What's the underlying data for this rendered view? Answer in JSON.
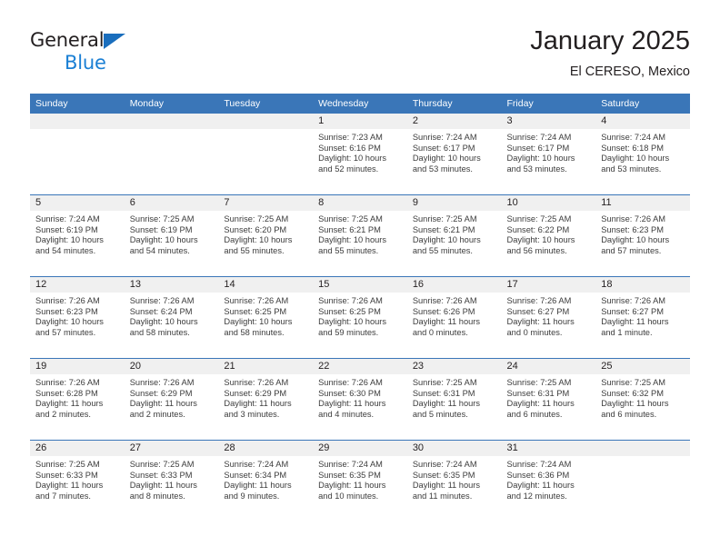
{
  "brand": {
    "line1": "General",
    "line2": "Blue",
    "flag_color": "#1a6ebd",
    "line2_color": "#1a7fd4"
  },
  "header": {
    "month_title": "January 2025",
    "location": "El CERESO, Mexico"
  },
  "theme": {
    "header_blue": "#3a76b8",
    "daynum_bg": "#f0f0f0",
    "text": "#231f20"
  },
  "calendar": {
    "weekday_headers": [
      "Sunday",
      "Monday",
      "Tuesday",
      "Wednesday",
      "Thursday",
      "Friday",
      "Saturday"
    ],
    "weeks": [
      [
        {
          "day": "",
          "sunrise": "",
          "sunset": "",
          "daylight1": "",
          "daylight2": ""
        },
        {
          "day": "",
          "sunrise": "",
          "sunset": "",
          "daylight1": "",
          "daylight2": ""
        },
        {
          "day": "",
          "sunrise": "",
          "sunset": "",
          "daylight1": "",
          "daylight2": ""
        },
        {
          "day": "1",
          "sunrise": "Sunrise: 7:23 AM",
          "sunset": "Sunset: 6:16 PM",
          "daylight1": "Daylight: 10 hours",
          "daylight2": "and 52 minutes."
        },
        {
          "day": "2",
          "sunrise": "Sunrise: 7:24 AM",
          "sunset": "Sunset: 6:17 PM",
          "daylight1": "Daylight: 10 hours",
          "daylight2": "and 53 minutes."
        },
        {
          "day": "3",
          "sunrise": "Sunrise: 7:24 AM",
          "sunset": "Sunset: 6:17 PM",
          "daylight1": "Daylight: 10 hours",
          "daylight2": "and 53 minutes."
        },
        {
          "day": "4",
          "sunrise": "Sunrise: 7:24 AM",
          "sunset": "Sunset: 6:18 PM",
          "daylight1": "Daylight: 10 hours",
          "daylight2": "and 53 minutes."
        }
      ],
      [
        {
          "day": "5",
          "sunrise": "Sunrise: 7:24 AM",
          "sunset": "Sunset: 6:19 PM",
          "daylight1": "Daylight: 10 hours",
          "daylight2": "and 54 minutes."
        },
        {
          "day": "6",
          "sunrise": "Sunrise: 7:25 AM",
          "sunset": "Sunset: 6:19 PM",
          "daylight1": "Daylight: 10 hours",
          "daylight2": "and 54 minutes."
        },
        {
          "day": "7",
          "sunrise": "Sunrise: 7:25 AM",
          "sunset": "Sunset: 6:20 PM",
          "daylight1": "Daylight: 10 hours",
          "daylight2": "and 55 minutes."
        },
        {
          "day": "8",
          "sunrise": "Sunrise: 7:25 AM",
          "sunset": "Sunset: 6:21 PM",
          "daylight1": "Daylight: 10 hours",
          "daylight2": "and 55 minutes."
        },
        {
          "day": "9",
          "sunrise": "Sunrise: 7:25 AM",
          "sunset": "Sunset: 6:21 PM",
          "daylight1": "Daylight: 10 hours",
          "daylight2": "and 55 minutes."
        },
        {
          "day": "10",
          "sunrise": "Sunrise: 7:25 AM",
          "sunset": "Sunset: 6:22 PM",
          "daylight1": "Daylight: 10 hours",
          "daylight2": "and 56 minutes."
        },
        {
          "day": "11",
          "sunrise": "Sunrise: 7:26 AM",
          "sunset": "Sunset: 6:23 PM",
          "daylight1": "Daylight: 10 hours",
          "daylight2": "and 57 minutes."
        }
      ],
      [
        {
          "day": "12",
          "sunrise": "Sunrise: 7:26 AM",
          "sunset": "Sunset: 6:23 PM",
          "daylight1": "Daylight: 10 hours",
          "daylight2": "and 57 minutes."
        },
        {
          "day": "13",
          "sunrise": "Sunrise: 7:26 AM",
          "sunset": "Sunset: 6:24 PM",
          "daylight1": "Daylight: 10 hours",
          "daylight2": "and 58 minutes."
        },
        {
          "day": "14",
          "sunrise": "Sunrise: 7:26 AM",
          "sunset": "Sunset: 6:25 PM",
          "daylight1": "Daylight: 10 hours",
          "daylight2": "and 58 minutes."
        },
        {
          "day": "15",
          "sunrise": "Sunrise: 7:26 AM",
          "sunset": "Sunset: 6:25 PM",
          "daylight1": "Daylight: 10 hours",
          "daylight2": "and 59 minutes."
        },
        {
          "day": "16",
          "sunrise": "Sunrise: 7:26 AM",
          "sunset": "Sunset: 6:26 PM",
          "daylight1": "Daylight: 11 hours",
          "daylight2": "and 0 minutes."
        },
        {
          "day": "17",
          "sunrise": "Sunrise: 7:26 AM",
          "sunset": "Sunset: 6:27 PM",
          "daylight1": "Daylight: 11 hours",
          "daylight2": "and 0 minutes."
        },
        {
          "day": "18",
          "sunrise": "Sunrise: 7:26 AM",
          "sunset": "Sunset: 6:27 PM",
          "daylight1": "Daylight: 11 hours",
          "daylight2": "and 1 minute."
        }
      ],
      [
        {
          "day": "19",
          "sunrise": "Sunrise: 7:26 AM",
          "sunset": "Sunset: 6:28 PM",
          "daylight1": "Daylight: 11 hours",
          "daylight2": "and 2 minutes."
        },
        {
          "day": "20",
          "sunrise": "Sunrise: 7:26 AM",
          "sunset": "Sunset: 6:29 PM",
          "daylight1": "Daylight: 11 hours",
          "daylight2": "and 2 minutes."
        },
        {
          "day": "21",
          "sunrise": "Sunrise: 7:26 AM",
          "sunset": "Sunset: 6:29 PM",
          "daylight1": "Daylight: 11 hours",
          "daylight2": "and 3 minutes."
        },
        {
          "day": "22",
          "sunrise": "Sunrise: 7:26 AM",
          "sunset": "Sunset: 6:30 PM",
          "daylight1": "Daylight: 11 hours",
          "daylight2": "and 4 minutes."
        },
        {
          "day": "23",
          "sunrise": "Sunrise: 7:25 AM",
          "sunset": "Sunset: 6:31 PM",
          "daylight1": "Daylight: 11 hours",
          "daylight2": "and 5 minutes."
        },
        {
          "day": "24",
          "sunrise": "Sunrise: 7:25 AM",
          "sunset": "Sunset: 6:31 PM",
          "daylight1": "Daylight: 11 hours",
          "daylight2": "and 6 minutes."
        },
        {
          "day": "25",
          "sunrise": "Sunrise: 7:25 AM",
          "sunset": "Sunset: 6:32 PM",
          "daylight1": "Daylight: 11 hours",
          "daylight2": "and 6 minutes."
        }
      ],
      [
        {
          "day": "26",
          "sunrise": "Sunrise: 7:25 AM",
          "sunset": "Sunset: 6:33 PM",
          "daylight1": "Daylight: 11 hours",
          "daylight2": "and 7 minutes."
        },
        {
          "day": "27",
          "sunrise": "Sunrise: 7:25 AM",
          "sunset": "Sunset: 6:33 PM",
          "daylight1": "Daylight: 11 hours",
          "daylight2": "and 8 minutes."
        },
        {
          "day": "28",
          "sunrise": "Sunrise: 7:24 AM",
          "sunset": "Sunset: 6:34 PM",
          "daylight1": "Daylight: 11 hours",
          "daylight2": "and 9 minutes."
        },
        {
          "day": "29",
          "sunrise": "Sunrise: 7:24 AM",
          "sunset": "Sunset: 6:35 PM",
          "daylight1": "Daylight: 11 hours",
          "daylight2": "and 10 minutes."
        },
        {
          "day": "30",
          "sunrise": "Sunrise: 7:24 AM",
          "sunset": "Sunset: 6:35 PM",
          "daylight1": "Daylight: 11 hours",
          "daylight2": "and 11 minutes."
        },
        {
          "day": "31",
          "sunrise": "Sunrise: 7:24 AM",
          "sunset": "Sunset: 6:36 PM",
          "daylight1": "Daylight: 11 hours",
          "daylight2": "and 12 minutes."
        },
        {
          "day": "",
          "sunrise": "",
          "sunset": "",
          "daylight1": "",
          "daylight2": ""
        }
      ]
    ]
  }
}
